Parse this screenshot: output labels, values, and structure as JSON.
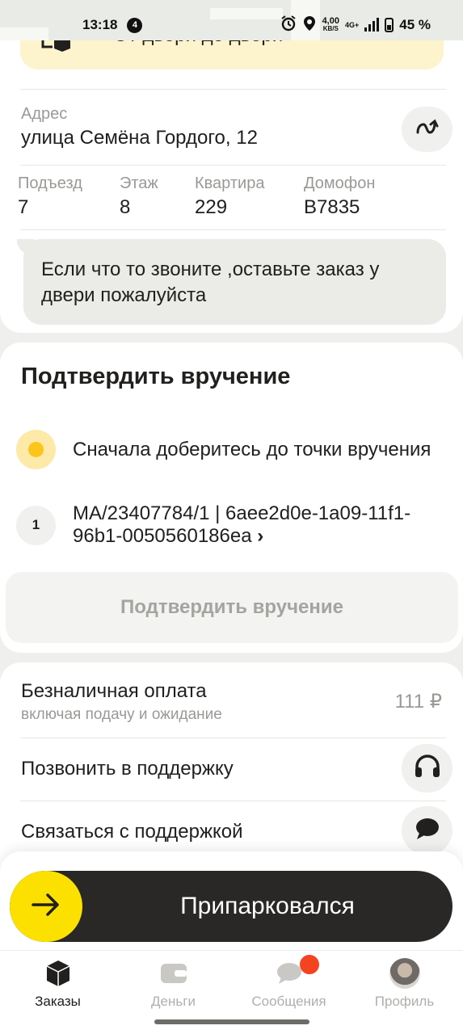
{
  "status_bar": {
    "time": "13:18",
    "notification_count": "4",
    "speed_value": "4,00",
    "speed_unit": "KB/S",
    "network": "4G+",
    "battery": "45 %"
  },
  "banner": {
    "text": "От двери до двери"
  },
  "address": {
    "label": "Адрес",
    "value": "улица Семёна Гордого, 12"
  },
  "fields": [
    {
      "label": "Подъезд",
      "value": "7"
    },
    {
      "label": "Этаж",
      "value": "8"
    },
    {
      "label": "Квартира",
      "value": "229"
    },
    {
      "label": "Домофон",
      "value": "B7835"
    }
  ],
  "comment": "Если что то звоните ,оставьте заказ у двери пожалуйста",
  "confirm": {
    "title": "Подтвердить вручение",
    "step_hint": "Сначала доберитесь до точки вручения",
    "order_number": "1",
    "order_text": "MA/23407784/1 | 6aee2d0e-1a09-11f1-96b1-0050560186ea",
    "order_chevron": "›",
    "button_label": "Подтвердить вручение"
  },
  "payment": {
    "title": "Безналичная оплата",
    "subtitle": "включая подачу и ожидание",
    "amount": "111 ₽"
  },
  "support": {
    "call_label": "Позвонить в поддержку",
    "chat_label": "Связаться с поддержкой"
  },
  "action": {
    "label": "Припарковался"
  },
  "tabs": [
    {
      "label": "Заказы",
      "icon": "box-icon",
      "active": true
    },
    {
      "label": "Деньги",
      "icon": "wallet-icon",
      "active": false
    },
    {
      "label": "Сообщения",
      "icon": "chat-icon",
      "active": false,
      "badge": true
    },
    {
      "label": "Профиль",
      "icon": "avatar",
      "active": false
    }
  ],
  "colors": {
    "accent_yellow": "#fce000",
    "swipe_dark": "#2a2826",
    "badge_red": "#f5431f",
    "muted_text": "#9a9996"
  }
}
